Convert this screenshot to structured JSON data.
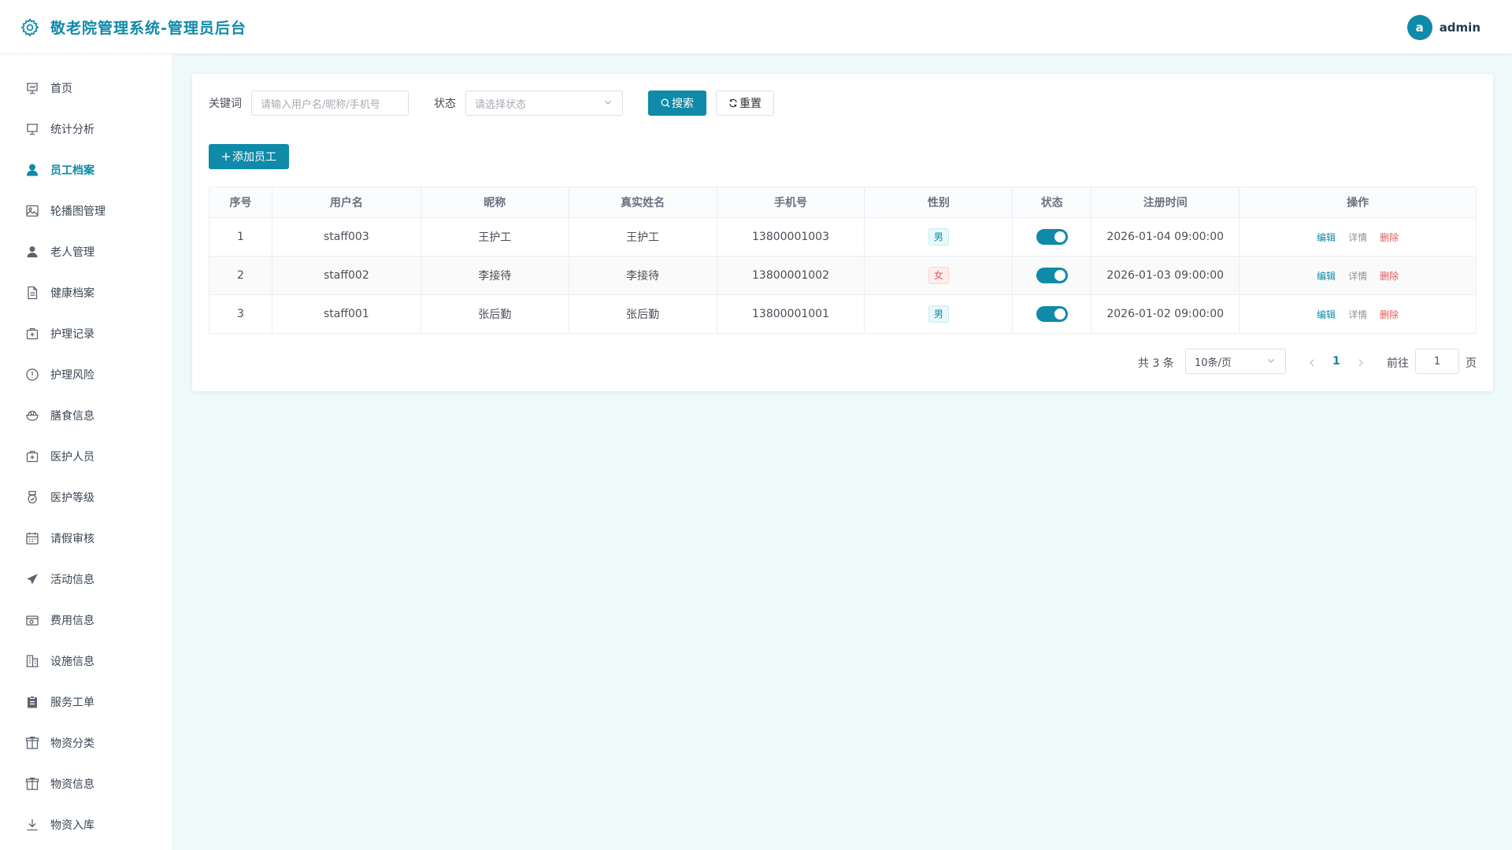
{
  "header": {
    "title": "敬老院管理系统-管理员后台",
    "avatar_letter": "a",
    "username": "admin"
  },
  "colors": {
    "primary": "#0f8aa8",
    "danger": "#e05a5a",
    "background": "#eefaf9"
  },
  "sidebar": {
    "items": [
      {
        "label": "首页",
        "icon": "presentation-chart-icon"
      },
      {
        "label": "统计分析",
        "icon": "presentation-board-icon"
      },
      {
        "label": "员工档案",
        "icon": "user-icon",
        "active": true
      },
      {
        "label": "轮播图管理",
        "icon": "picture-icon"
      },
      {
        "label": "老人管理",
        "icon": "user-icon"
      },
      {
        "label": "健康档案",
        "icon": "document-icon"
      },
      {
        "label": "护理记录",
        "icon": "first-aid-kit-icon"
      },
      {
        "label": "护理风险",
        "icon": "warning-circle-icon"
      },
      {
        "label": "膳食信息",
        "icon": "bowl-icon"
      },
      {
        "label": "医护人员",
        "icon": "first-aid-kit-icon"
      },
      {
        "label": "医护等级",
        "icon": "medal-icon"
      },
      {
        "label": "请假审核",
        "icon": "calendar-icon"
      },
      {
        "label": "活动信息",
        "icon": "paper-plane-icon"
      },
      {
        "label": "费用信息",
        "icon": "wallet-icon"
      },
      {
        "label": "设施信息",
        "icon": "building-icon"
      },
      {
        "label": "服务工单",
        "icon": "clipboard-icon"
      },
      {
        "label": "物资分类",
        "icon": "box-icon"
      },
      {
        "label": "物资信息",
        "icon": "box-icon"
      },
      {
        "label": "物资入库",
        "icon": "download-icon"
      }
    ]
  },
  "filters": {
    "keyword_label": "关键词",
    "keyword_placeholder": "请输入用户名/昵称/手机号",
    "status_label": "状态",
    "status_placeholder": "请选择状态",
    "search_button": "搜索",
    "reset_button": "重置"
  },
  "actions": {
    "add_button": "添加员工"
  },
  "table": {
    "columns": [
      "序号",
      "用户名",
      "昵称",
      "真实姓名",
      "手机号",
      "性别",
      "状态",
      "注册时间",
      "操作"
    ],
    "op_labels": {
      "edit": "编辑",
      "detail": "详情",
      "delete": "删除"
    },
    "rows": [
      {
        "index": "1",
        "username": "staff003",
        "nickname": "王护工",
        "real_name": "王护工",
        "phone": "13800001003",
        "gender": "男",
        "status_enabled": true,
        "registered": "2026-01-04 09:00:00"
      },
      {
        "index": "2",
        "username": "staff002",
        "nickname": "李接待",
        "real_name": "李接待",
        "phone": "13800001002",
        "gender": "女",
        "status_enabled": true,
        "registered": "2026-01-03 09:00:00"
      },
      {
        "index": "3",
        "username": "staff001",
        "nickname": "张后勤",
        "real_name": "张后勤",
        "phone": "13800001001",
        "gender": "男",
        "status_enabled": true,
        "registered": "2026-01-02 09:00:00"
      }
    ]
  },
  "pagination": {
    "total_text": "共 3 条",
    "page_size": "10条/页",
    "current_page": "1",
    "goto_label": "前往",
    "goto_value": "1",
    "page_suffix": "页"
  }
}
